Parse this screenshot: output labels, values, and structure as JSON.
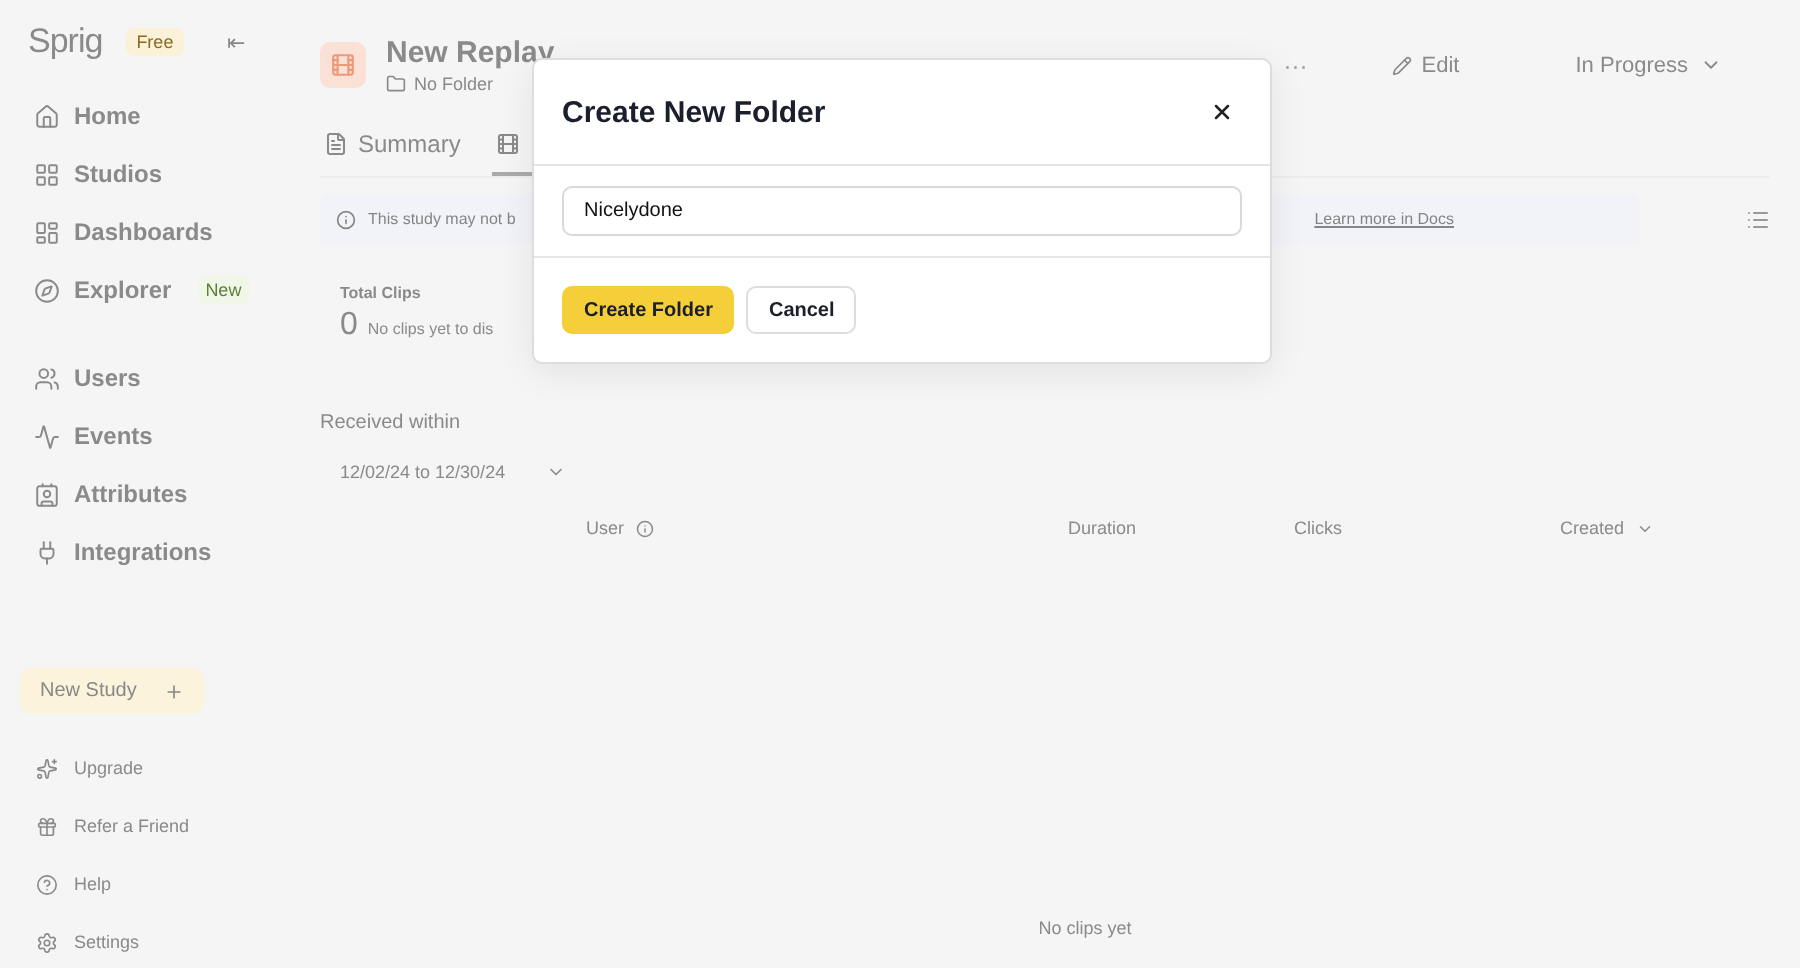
{
  "sidebar": {
    "logo": "Sprig",
    "plan_badge": "Free",
    "collapse_icon": "⇤",
    "nav": [
      {
        "label": "Home"
      },
      {
        "label": "Studios"
      },
      {
        "label": "Dashboards"
      },
      {
        "label": "Explorer",
        "badge": "New"
      }
    ],
    "nav2": [
      {
        "label": "Users"
      },
      {
        "label": "Events"
      },
      {
        "label": "Attributes"
      },
      {
        "label": "Integrations"
      }
    ],
    "new_study": "New Study",
    "footer": [
      {
        "label": "Upgrade"
      },
      {
        "label": "Refer a Friend"
      },
      {
        "label": "Help"
      },
      {
        "label": "Settings"
      }
    ]
  },
  "study": {
    "title": "New Replay",
    "folder": "No Folder",
    "more": "···",
    "edit": "Edit",
    "status": "In Progress"
  },
  "tabs": [
    {
      "label": "Summary",
      "selected": false
    },
    {
      "selected": true
    }
  ],
  "banner": {
    "text": "This study may not b",
    "link": "Learn more in Docs"
  },
  "stats": {
    "label": "Total Clips",
    "value": "0",
    "note": "No clips yet to dis"
  },
  "filter": {
    "label": "Received within",
    "range": "12/02/24 to 12/30/24"
  },
  "table": {
    "columns": [
      "User",
      "Duration",
      "Clicks",
      "Created"
    ],
    "empty": "No clips yet"
  },
  "dialog": {
    "title": "Create New Folder",
    "input_value": "Nicelydone",
    "primary": "Create Folder",
    "secondary": "Cancel"
  }
}
